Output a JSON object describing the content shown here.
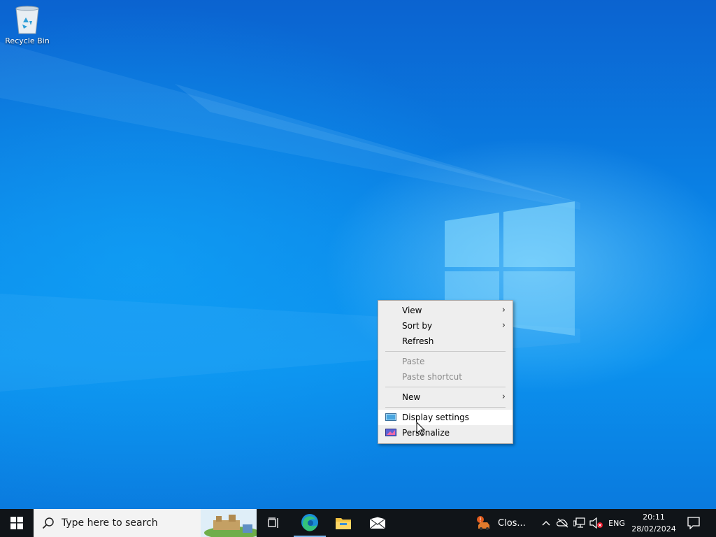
{
  "desktop": {
    "icons": [
      {
        "label": "Recycle Bin",
        "icon": "recycle-bin-icon"
      }
    ]
  },
  "context_menu": {
    "items": [
      {
        "label": "View",
        "submenu": true,
        "enabled": true
      },
      {
        "label": "Sort by",
        "submenu": true,
        "enabled": true
      },
      {
        "label": "Refresh",
        "submenu": false,
        "enabled": true
      },
      {
        "separator": true
      },
      {
        "label": "Paste",
        "submenu": false,
        "enabled": false
      },
      {
        "label": "Paste shortcut",
        "submenu": false,
        "enabled": false
      },
      {
        "separator": true
      },
      {
        "label": "New",
        "submenu": true,
        "enabled": true
      },
      {
        "separator": true
      },
      {
        "label": "Display settings",
        "icon": "display-settings-icon",
        "enabled": true,
        "hovered": true
      },
      {
        "label": "Personalize",
        "icon": "personalize-icon",
        "enabled": true
      }
    ]
  },
  "taskbar": {
    "search_placeholder": "Type here to search",
    "pinned": [
      "task-view-icon",
      "edge-icon",
      "file-explorer-icon",
      "mail-icon"
    ],
    "running_app_label": "Clos...",
    "tray_language": "ENG",
    "clock_time": "20:11",
    "clock_date": "28/02/2024"
  },
  "colors": {
    "accent": "#0078d7",
    "taskbar": "#101418",
    "menu_bg": "#eeeeee",
    "menu_hover": "#ffffff",
    "disabled_text": "#8a8a8a"
  }
}
